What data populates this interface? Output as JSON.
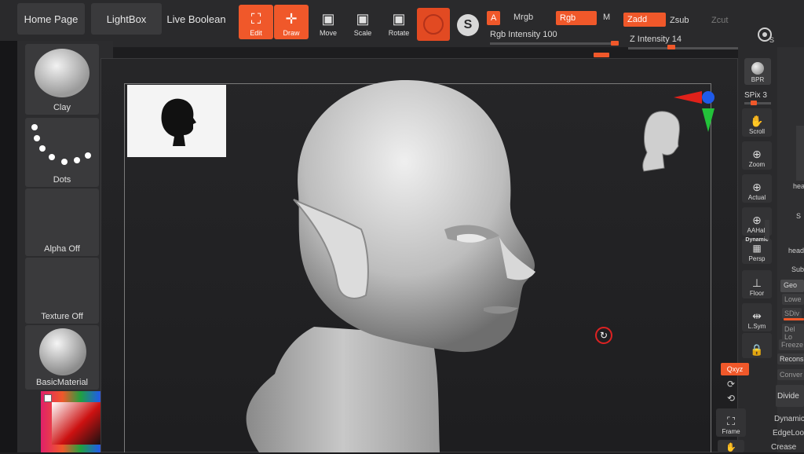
{
  "header": {
    "tabs": [
      "Home Page",
      "LightBox",
      "Live Boolean"
    ],
    "tools": [
      {
        "label": "Edit",
        "active": true
      },
      {
        "label": "Draw",
        "active": true
      },
      {
        "label": "Move",
        "active": false
      },
      {
        "label": "Scale",
        "active": false
      },
      {
        "label": "Rotate",
        "active": false
      }
    ],
    "modes": {
      "a": "A",
      "mrgb": "Mrgb",
      "rgb": "Rgb",
      "m": "M",
      "zadd": "Zadd",
      "zsub": "Zsub",
      "zcut": "Zcut"
    },
    "rgb_intensity_label": "Rgb Intensity 100",
    "z_intensity_label": "Z Intensity 14"
  },
  "left_shelf": {
    "brush": "Clay",
    "stroke": "Dots",
    "alpha": "Alpha Off",
    "texture": "Texture Off",
    "material": "BasicMaterial"
  },
  "right_shelf": {
    "bpr": "BPR",
    "spix": "SPix 3",
    "buttons": [
      "Scroll",
      "Zoom",
      "Actual",
      "AAHalf",
      "Dynamic",
      "Persp",
      "Floor",
      "L.Sym",
      "Qxyz",
      "Frame"
    ]
  },
  "far_right": {
    "items": [
      "Sub",
      "Geo",
      "Lowe",
      "SDiv",
      "Del Lo",
      "Freeze",
      "Recons",
      "Conver",
      "Divide",
      "Dynamic",
      "EdgeLoop",
      "Crease"
    ],
    "head_label": "hea",
    "s_label": "S",
    "heads_label": "head"
  },
  "colors": {
    "accent": "#f0582a",
    "panel": "#2c2c2e",
    "canvas": "#232325"
  }
}
